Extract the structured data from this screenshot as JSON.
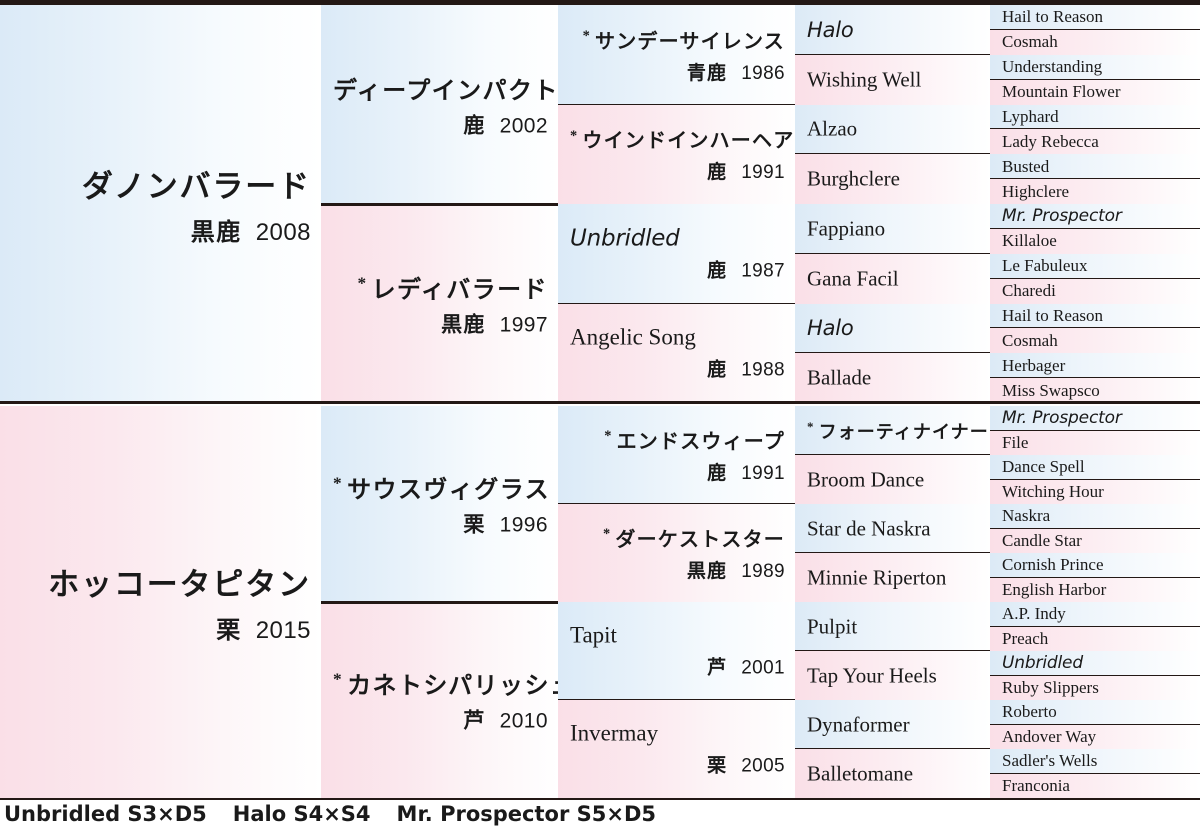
{
  "footer": {
    "inbreeding": [
      "Unbridled S3×D5",
      "Halo S4×S4",
      "Mr. Prospector S5×D5"
    ]
  },
  "pedigrees": [
    {
      "subject": {
        "name": "ダノンバラード",
        "coat": "黒鹿",
        "year": "2008",
        "script": "jp",
        "tone": "blue"
      },
      "gen1": [
        {
          "name": "ディープインパクト",
          "coat": "鹿",
          "year": "2002",
          "script": "jp",
          "tone": "blue",
          "star": false
        },
        {
          "name": "レディバラード",
          "coat": "黒鹿",
          "year": "1997",
          "script": "jp",
          "tone": "pink",
          "star": true
        }
      ],
      "gen2": [
        {
          "name": "サンデーサイレンス",
          "coat": "青鹿",
          "year": "1986",
          "script": "jp",
          "tone": "blue",
          "star": true
        },
        {
          "name": "ウインドインハーヘア",
          "coat": "鹿",
          "year": "1991",
          "script": "jp",
          "tone": "pink",
          "star": true
        },
        {
          "name": "Unbridled",
          "coat": "鹿",
          "year": "1987",
          "script": "hl",
          "tone": "blue",
          "star": false
        },
        {
          "name": "Angelic Song",
          "coat": "鹿",
          "year": "1988",
          "script": "en",
          "tone": "pink",
          "star": false
        }
      ],
      "gen3": [
        {
          "name": "Halo",
          "script": "hl",
          "tone": "blue",
          "star": false
        },
        {
          "name": "Wishing Well",
          "script": "en",
          "tone": "pink",
          "star": false
        },
        {
          "name": "Alzao",
          "script": "en",
          "tone": "blue",
          "star": false
        },
        {
          "name": "Burghclere",
          "script": "en",
          "tone": "pink",
          "star": false
        },
        {
          "name": "Fappiano",
          "script": "en",
          "tone": "blue",
          "star": false
        },
        {
          "name": "Gana Facil",
          "script": "en",
          "tone": "pink",
          "star": false
        },
        {
          "name": "Halo",
          "script": "hl",
          "tone": "blue",
          "star": false
        },
        {
          "name": "Ballade",
          "script": "en",
          "tone": "pink",
          "star": false
        }
      ],
      "gen4": [
        {
          "name": "Hail to Reason",
          "script": "en",
          "tone": "blue"
        },
        {
          "name": "Cosmah",
          "script": "en",
          "tone": "pink"
        },
        {
          "name": "Understanding",
          "script": "en",
          "tone": "blue"
        },
        {
          "name": "Mountain Flower",
          "script": "en",
          "tone": "pink"
        },
        {
          "name": "Lyphard",
          "script": "en",
          "tone": "blue"
        },
        {
          "name": "Lady Rebecca",
          "script": "en",
          "tone": "pink"
        },
        {
          "name": "Busted",
          "script": "en",
          "tone": "blue"
        },
        {
          "name": "Highclere",
          "script": "en",
          "tone": "pink"
        },
        {
          "name": "Mr. Prospector",
          "script": "hl",
          "tone": "blue"
        },
        {
          "name": "Killaloe",
          "script": "en",
          "tone": "pink"
        },
        {
          "name": "Le Fabuleux",
          "script": "en",
          "tone": "blue"
        },
        {
          "name": "Charedi",
          "script": "en",
          "tone": "pink"
        },
        {
          "name": "Hail to Reason",
          "script": "en",
          "tone": "blue"
        },
        {
          "name": "Cosmah",
          "script": "en",
          "tone": "pink"
        },
        {
          "name": "Herbager",
          "script": "en",
          "tone": "blue"
        },
        {
          "name": "Miss Swapsco",
          "script": "en",
          "tone": "pink"
        }
      ]
    },
    {
      "subject": {
        "name": "ホッコータピタン",
        "coat": "栗",
        "year": "2015",
        "script": "jp",
        "tone": "pink"
      },
      "gen1": [
        {
          "name": "サウスヴィグラス",
          "coat": "栗",
          "year": "1996",
          "script": "jp",
          "tone": "blue",
          "star": true
        },
        {
          "name": "カネトシパリッシュ",
          "coat": "芦",
          "year": "2010",
          "script": "jp",
          "tone": "pink",
          "star": true
        }
      ],
      "gen2": [
        {
          "name": "エンドスウィープ",
          "coat": "鹿",
          "year": "1991",
          "script": "jp",
          "tone": "blue",
          "star": true
        },
        {
          "name": "ダーケストスター",
          "coat": "黒鹿",
          "year": "1989",
          "script": "jp",
          "tone": "pink",
          "star": true
        },
        {
          "name": "Tapit",
          "coat": "芦",
          "year": "2001",
          "script": "en",
          "tone": "blue",
          "star": false
        },
        {
          "name": "Invermay",
          "coat": "栗",
          "year": "2005",
          "script": "en",
          "tone": "pink",
          "star": false
        }
      ],
      "gen3": [
        {
          "name": "フォーティナイナー",
          "script": "jp",
          "tone": "blue",
          "star": true
        },
        {
          "name": "Broom Dance",
          "script": "en",
          "tone": "pink",
          "star": false
        },
        {
          "name": "Star de Naskra",
          "script": "en",
          "tone": "blue",
          "star": false
        },
        {
          "name": "Minnie Riperton",
          "script": "en",
          "tone": "pink",
          "star": false
        },
        {
          "name": "Pulpit",
          "script": "en",
          "tone": "blue",
          "star": false
        },
        {
          "name": "Tap Your Heels",
          "script": "en",
          "tone": "pink",
          "star": false
        },
        {
          "name": "Dynaformer",
          "script": "en",
          "tone": "blue",
          "star": false
        },
        {
          "name": "Balletomane",
          "script": "en",
          "tone": "pink",
          "star": false
        }
      ],
      "gen4": [
        {
          "name": "Mr. Prospector",
          "script": "hl",
          "tone": "blue"
        },
        {
          "name": "File",
          "script": "en",
          "tone": "pink"
        },
        {
          "name": "Dance Spell",
          "script": "en",
          "tone": "blue"
        },
        {
          "name": "Witching Hour",
          "script": "en",
          "tone": "pink"
        },
        {
          "name": "Naskra",
          "script": "en",
          "tone": "blue"
        },
        {
          "name": "Candle Star",
          "script": "en",
          "tone": "pink"
        },
        {
          "name": "Cornish Prince",
          "script": "en",
          "tone": "blue"
        },
        {
          "name": "English Harbor",
          "script": "en",
          "tone": "pink"
        },
        {
          "name": "A.P. Indy",
          "script": "en",
          "tone": "blue"
        },
        {
          "name": "Preach",
          "script": "en",
          "tone": "pink"
        },
        {
          "name": "Unbridled",
          "script": "hl",
          "tone": "blue"
        },
        {
          "name": "Ruby Slippers",
          "script": "en",
          "tone": "pink"
        },
        {
          "name": "Roberto",
          "script": "en",
          "tone": "blue"
        },
        {
          "name": "Andover Way",
          "script": "en",
          "tone": "pink"
        },
        {
          "name": "Sadler's Wells",
          "script": "en",
          "tone": "blue"
        },
        {
          "name": "Franconia",
          "script": "en",
          "tone": "pink"
        }
      ]
    }
  ]
}
